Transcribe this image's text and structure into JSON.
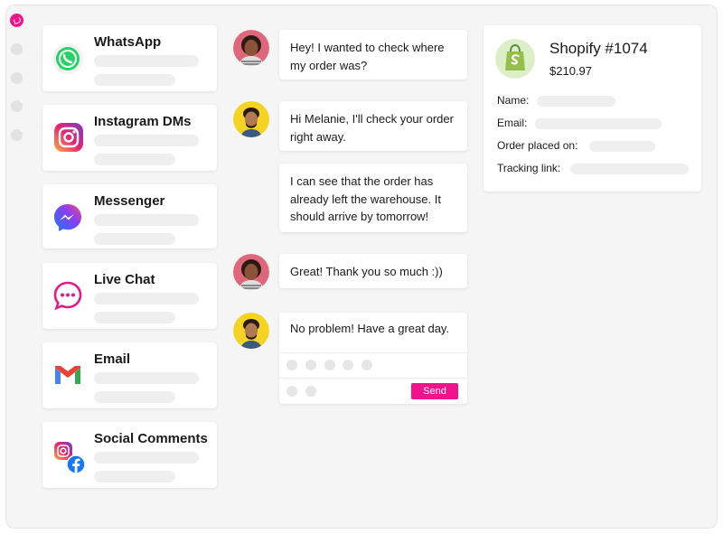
{
  "channels": [
    {
      "name": "WhatsApp",
      "icon": "whatsapp-icon"
    },
    {
      "name": "Instagram DMs",
      "icon": "instagram-icon"
    },
    {
      "name": "Messenger",
      "icon": "messenger-icon"
    },
    {
      "name": "Live Chat",
      "icon": "live-chat-icon"
    },
    {
      "name": "Email",
      "icon": "gmail-icon"
    },
    {
      "name": "Social Comments",
      "icon": "instagram-facebook-icon"
    }
  ],
  "chat": {
    "messages": [
      {
        "sender": "customer",
        "text": "Hey! I wanted to check where my order was?"
      },
      {
        "sender": "agent",
        "text": "Hi Melanie, I'll check your order right away."
      },
      {
        "sender": "agent",
        "text": "I can see that the order has already left the warehouse. It should arrive by tomorrow!"
      },
      {
        "sender": "customer",
        "text": "Great! Thank you so much :))"
      }
    ],
    "draft": "No problem! Have a great day.",
    "send_label": "Send"
  },
  "order": {
    "title": "Shopify #1074",
    "price": "$210.97",
    "fields": [
      "Name:",
      "Email:",
      "Order placed on:",
      "Tracking link:"
    ]
  },
  "colors": {
    "brand": "#f0148c",
    "whatsapp": "#25d366",
    "shopify": "#95bf47"
  }
}
